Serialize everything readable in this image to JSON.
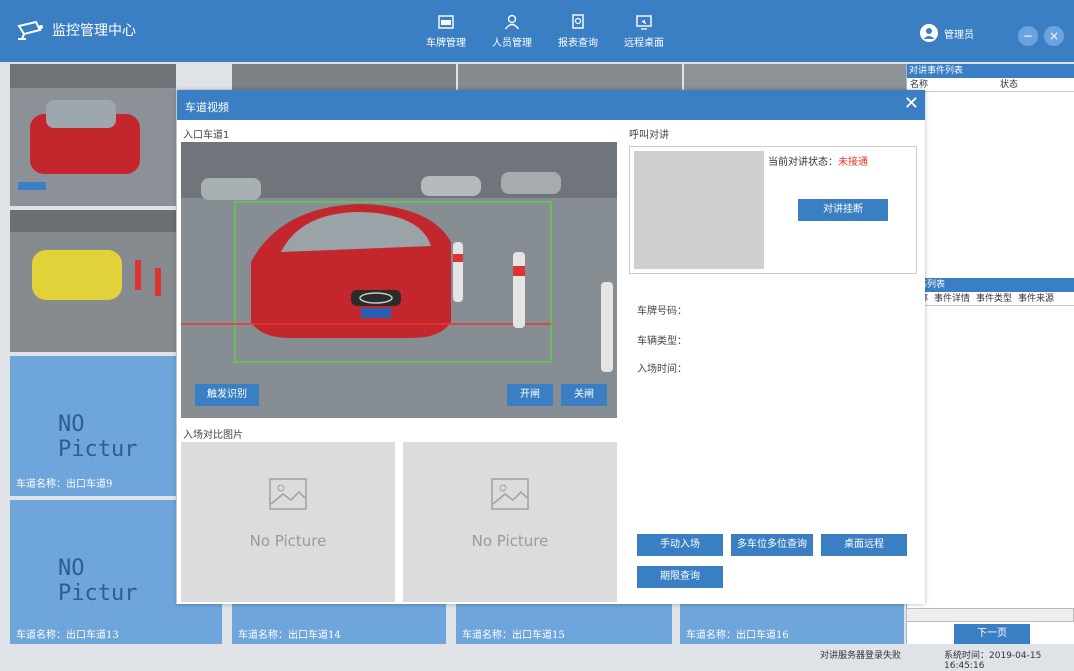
{
  "app": {
    "title": "监控管理中心"
  },
  "nav": [
    {
      "label": "车牌管理",
      "icon": "plate-icon"
    },
    {
      "label": "人员管理",
      "icon": "person-icon"
    },
    {
      "label": "报表查询",
      "icon": "report-icon"
    },
    {
      "label": "远程桌面",
      "icon": "remote-desktop-icon"
    }
  ],
  "user": {
    "name": "管理员"
  },
  "lanes": {
    "lane9": "车道名称：出口车道9",
    "lane13": "车道名称：出口车道13",
    "lane14": "车道名称：出口车道14",
    "lane15": "车道名称：出口车道15",
    "lane16": "车道名称：出口车道16",
    "no_picture": "NO Pictur"
  },
  "right_panel": {
    "talk_title": "对讲事件列表",
    "talk_cols": [
      "名称",
      "状态"
    ],
    "status_title": "状态列表",
    "status_cols": [
      "名称",
      "事件详情",
      "事件类型",
      "事件来源"
    ],
    "next_page": "下一页"
  },
  "modal": {
    "title": "车道视频",
    "entry_lane": "入口车道1",
    "trigger": "触发识别",
    "open_gate": "开闸",
    "close_gate": "关闸",
    "compare_label": "入场对比图片",
    "no_picture": "No Picture",
    "call_label": "呼叫对讲",
    "call_status_label": "当前对讲状态：",
    "call_status_value": "未接通",
    "hangup": "对讲挂断",
    "plate_label": "车牌号码：",
    "type_label": "车辆类型：",
    "time_label": "入场时间：",
    "manual_entry": "手动入场",
    "multi_query": "多车位多位查询",
    "desktop_remote": "桌面远程",
    "period_query": "期限查询"
  },
  "statusbar": {
    "server": "对讲服务器登录失败",
    "time": "系统时间：2019-04-15 16:45:16"
  },
  "colors": {
    "primary": "#3a7fc4",
    "alert": "#e0392b"
  }
}
